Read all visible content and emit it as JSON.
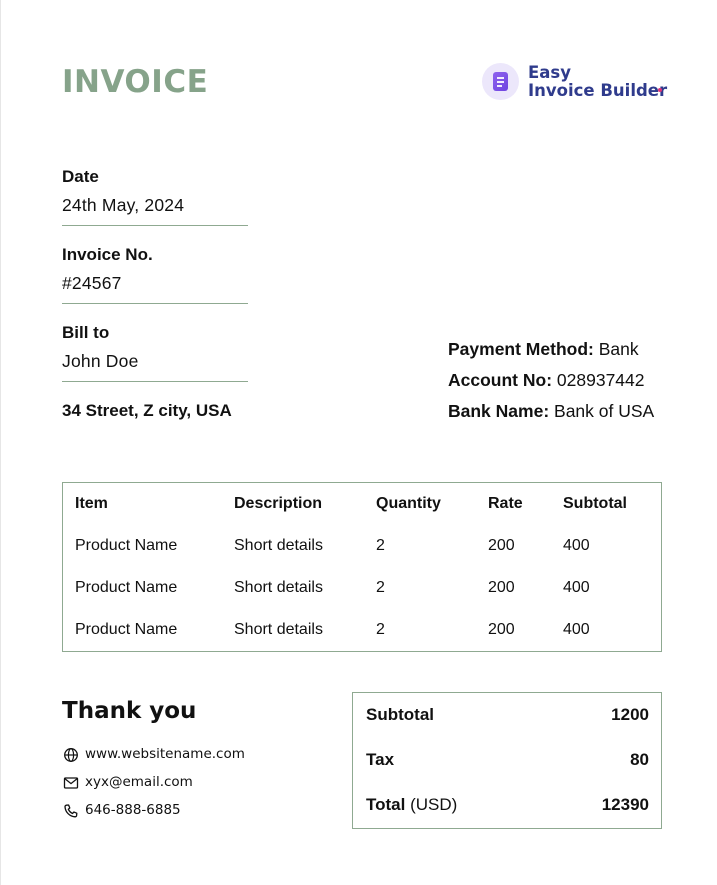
{
  "header": {
    "title": "INVOICE",
    "brand_line1": "Easy",
    "brand_line2": "Invoice Builder",
    "brand_icon": "invoice-document-icon",
    "accent_color": "#86a38a",
    "brand_color": "#2f3b8c"
  },
  "fields": {
    "date_label": "Date",
    "date_value": "24th May, 2024",
    "invoice_no_label": "Invoice No.",
    "invoice_no_value": "#24567",
    "bill_to_label": "Bill to",
    "bill_to_value": "John Doe",
    "address": "34 Street, Z city, USA"
  },
  "payment": {
    "method_label": "Payment Method:",
    "method_value": "Bank",
    "account_label": "Account No:",
    "account_value": "028937442",
    "bank_label": "Bank Name:",
    "bank_value": "Bank of USA"
  },
  "items_table": {
    "headers": [
      "Item",
      "Description",
      "Quantity",
      "Rate",
      "Subtotal"
    ],
    "rows": [
      [
        "Product Name",
        "Short details",
        "2",
        "200",
        "400"
      ],
      [
        "Product Name",
        "Short details",
        "2",
        "200",
        "400"
      ],
      [
        "Product Name",
        "Short details",
        "2",
        "200",
        "400"
      ]
    ]
  },
  "footer": {
    "thanks": "Thank you",
    "website_icon": "globe-icon",
    "website": "www.websitename.com",
    "email_icon": "mail-icon",
    "email": "xyx@email.com",
    "phone_icon": "phone-icon",
    "phone": "646-888-6885"
  },
  "totals": {
    "subtotal_label": "Subtotal",
    "subtotal_value": "1200",
    "tax_label": "Tax",
    "tax_value": "80",
    "total_label": "Total",
    "total_unit": "(USD)",
    "total_value": "12390"
  }
}
